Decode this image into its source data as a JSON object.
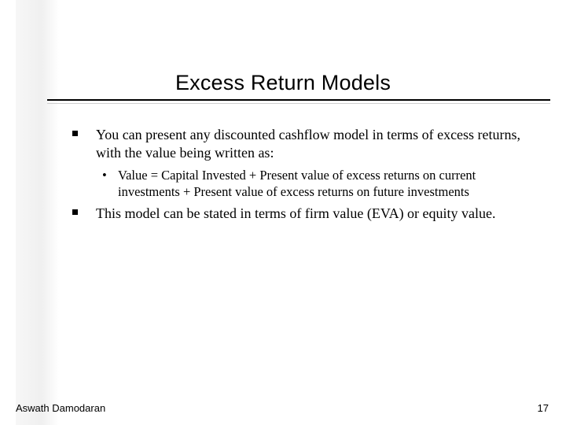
{
  "title": "Excess Return Models",
  "bullets": [
    {
      "level": 1,
      "text": "You can present any discounted cashflow model in terms of excess returns, with the value being written as:"
    },
    {
      "level": 2,
      "text": "Value = Capital Invested + Present value of excess returns on current investments + Present value of excess returns on future investments"
    },
    {
      "level": 1,
      "text": "This model can be stated in terms of firm value (EVA) or equity value."
    }
  ],
  "footer": {
    "author": "Aswath Damodaran",
    "page": "17"
  }
}
